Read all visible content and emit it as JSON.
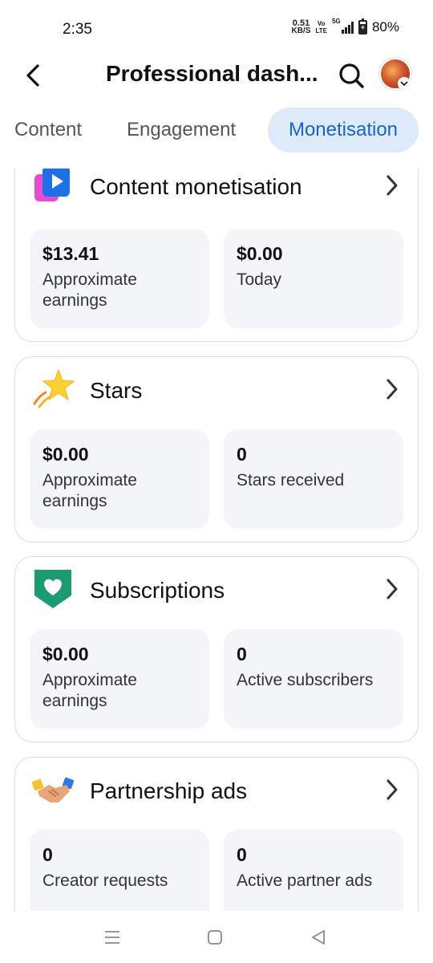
{
  "status_bar": {
    "time": "2:35",
    "net_speed_value": "0.51",
    "net_speed_unit": "KB/S",
    "volte_top": "Vo",
    "volte_bottom": "LTE",
    "network": "5G",
    "battery_percent": "80%"
  },
  "header": {
    "title": "Professional dash...",
    "back_icon": "back-arrow-icon",
    "search_icon": "search-icon"
  },
  "tabs": [
    {
      "label": "Content",
      "active": false
    },
    {
      "label": "Engagement",
      "active": false
    },
    {
      "label": "Monetisation",
      "active": true
    }
  ],
  "cards": [
    {
      "title": "Content monetisation",
      "icon": "content-monetisation-icon",
      "tiles": [
        {
          "value": "$13.41",
          "label": "Approximate earnings"
        },
        {
          "value": "$0.00",
          "label": "Today"
        }
      ]
    },
    {
      "title": "Stars",
      "icon": "star-icon",
      "tiles": [
        {
          "value": "$0.00",
          "label": "Approximate earnings"
        },
        {
          "value": "0",
          "label": "Stars received"
        }
      ]
    },
    {
      "title": "Subscriptions",
      "icon": "heart-badge-icon",
      "tiles": [
        {
          "value": "$0.00",
          "label": "Approximate earnings"
        },
        {
          "value": "0",
          "label": "Active subscribers"
        }
      ]
    },
    {
      "title": "Partnership ads",
      "icon": "handshake-icon",
      "tiles": [
        {
          "value": "0",
          "label": "Creator requests"
        },
        {
          "value": "0",
          "label": "Active partner ads"
        }
      ]
    }
  ],
  "colors": {
    "accent": "#1a63c9",
    "active_tab_bg": "#ddeaf9",
    "tile_bg": "#f3f5f8",
    "card_border": "#dcdcdc"
  }
}
